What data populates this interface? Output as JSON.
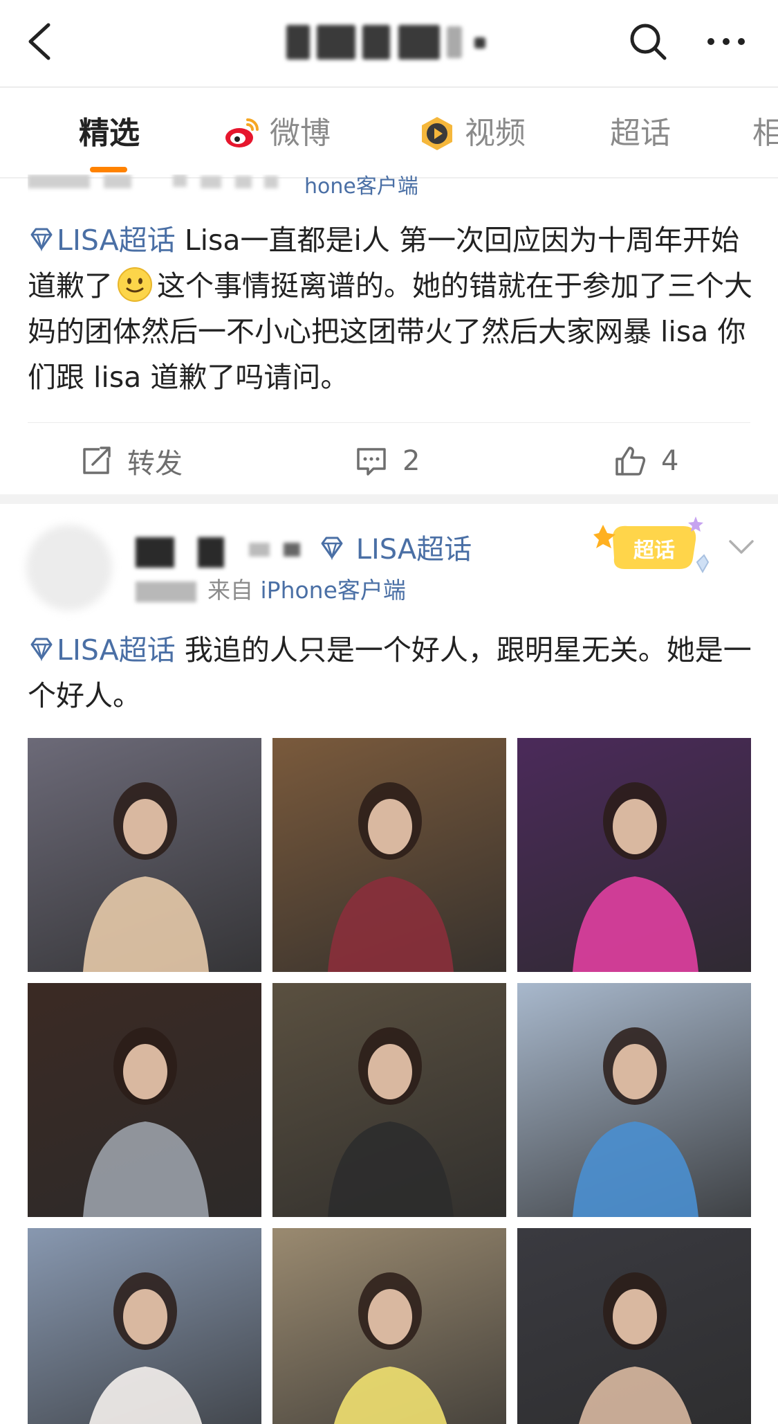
{
  "nav": {
    "back_icon": "chevron-left-icon",
    "search_icon": "search-icon",
    "more_icon": "more-dots-icon"
  },
  "tabs": [
    {
      "label": "精选",
      "active": true
    },
    {
      "label": "微博",
      "icon": "weibo-logo-icon"
    },
    {
      "label": "视频",
      "icon": "video-play-icon"
    },
    {
      "label": "超话"
    },
    {
      "label": "相"
    }
  ],
  "post1": {
    "prev_source": "hone客户端",
    "topic": "LISA超话",
    "text_part1": " Lisa一直都是i人 第一次回应因为十周年开始道歉了",
    "text_part2": "这个事情挺离谱的。她的错就在于参加了三个大妈的团体然后一不小心把这团带火了然后大家网暴 lisa 你们跟 lisa 道歉了吗请问。",
    "actions": {
      "repost_label": "转发",
      "comment_count": "2",
      "like_count": "4"
    }
  },
  "post2": {
    "topic_badge": "LISA超话",
    "date": "6-15",
    "source_prefix": "来自",
    "source": "iPhone客户端",
    "badge_label": "超话",
    "topic": "LISA超话",
    "text": " 我追的人只是一个好人，跟明星无关。她是一个好人。",
    "photos": [
      {
        "name": "photo-1",
        "bg": "#6c6a78",
        "accent": "#e6c9a8"
      },
      {
        "name": "photo-2",
        "bg": "#7a5a3c",
        "accent": "#8a2f3b"
      },
      {
        "name": "photo-3",
        "bg": "#4b2a5a",
        "accent": "#e03fa0"
      },
      {
        "name": "photo-4",
        "bg": "#3b2a24",
        "accent": "#9aa0a8"
      },
      {
        "name": "photo-5",
        "bg": "#5a5040",
        "accent": "#2c2c2c"
      },
      {
        "name": "photo-6",
        "bg": "#a8b8cc",
        "accent": "#4a8fd0"
      },
      {
        "name": "photo-7",
        "bg": "#8898b0",
        "accent": "#f4f0ec"
      },
      {
        "name": "photo-8",
        "bg": "#9a8a70",
        "accent": "#f0e070"
      },
      {
        "name": "photo-9",
        "bg": "#3a3a40",
        "accent": "#d8b8a0"
      }
    ]
  }
}
